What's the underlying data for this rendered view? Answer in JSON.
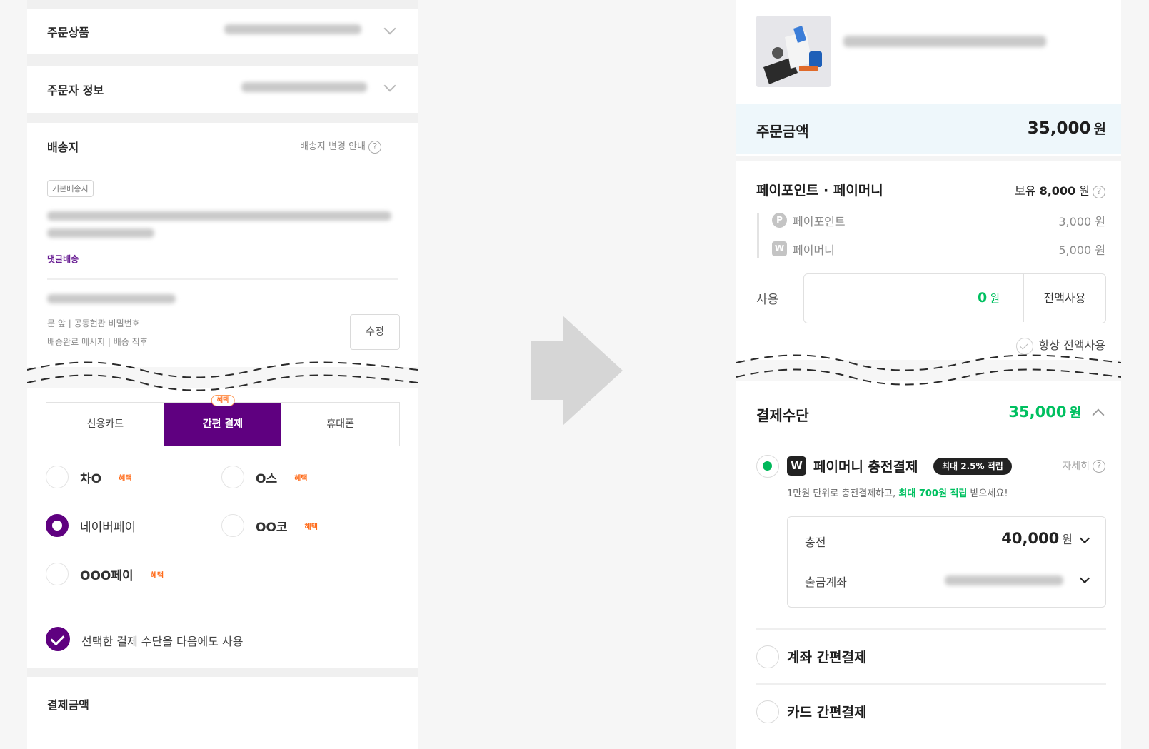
{
  "left": {
    "order_items": {
      "label": "주문상품"
    },
    "orderer": {
      "label": "주문자 정보"
    },
    "shipping": {
      "label": "배송지",
      "change_guide": "배송지 변경 안내",
      "default_tag": "기본배송지",
      "delivery_type": "댓글배송",
      "request_line1": "문 앞 | 공동현관 비밀번호",
      "request_line2": "배송완료 메시지 | 배송 직후",
      "edit_button": "수정"
    },
    "payment_tabs": {
      "tabs": [
        "신용카드",
        "간편 결제",
        "휴대폰"
      ],
      "badge": "혜택"
    },
    "easy_pay_options": [
      {
        "label": "차O",
        "benefit": "혜택"
      },
      {
        "label": "O스",
        "benefit": "혜택"
      },
      {
        "label": "네이버페이",
        "benefit": ""
      },
      {
        "label": "OO코",
        "benefit": "혜택"
      },
      {
        "label": "OOO페이",
        "benefit": "혜택"
      }
    ],
    "save_method": "선택한 결제 수단을 다음에도 사용",
    "payment_amount": {
      "label": "결제금액"
    }
  },
  "right": {
    "order_amount": {
      "label": "주문금액",
      "value": "35,000",
      "unit": "원"
    },
    "points": {
      "title": "페이포인트 · 페이머니",
      "holding_label": "보유",
      "holding_value": "8,000",
      "holding_unit": "원",
      "pay_point_label": "페이포인트",
      "pay_point_value": "3,000 원",
      "pay_money_label": "페이머니",
      "pay_money_value": "5,000 원",
      "use_label": "사용",
      "use_value": "0",
      "use_unit": "원",
      "use_all_button": "전액사용",
      "always_use_all": "항상 전액사용"
    },
    "payment_method": {
      "title": "결제수단",
      "amount": "35,000",
      "unit": "원",
      "paymoney_charge": {
        "icon_letter": "W",
        "label": "페이머니 충전결제",
        "pill": "최대 2.5% 적립",
        "detail_link": "자세히",
        "desc_prefix": "1만원 단위로 충전결제하고, ",
        "desc_highlight": "최대 700원 적립",
        "desc_suffix": " 받으세요!",
        "charge_label": "충전",
        "charge_value": "40,000",
        "charge_unit": "원",
        "account_label": "출금계좌"
      },
      "account_easy_pay": "계좌 간편결제",
      "card_easy_pay": "카드 간편결제"
    }
  },
  "colors": {
    "purple": "#5f0080",
    "green": "#00c060",
    "orange": "#ff6b1a",
    "order_row_bg": "#eef7fb"
  }
}
